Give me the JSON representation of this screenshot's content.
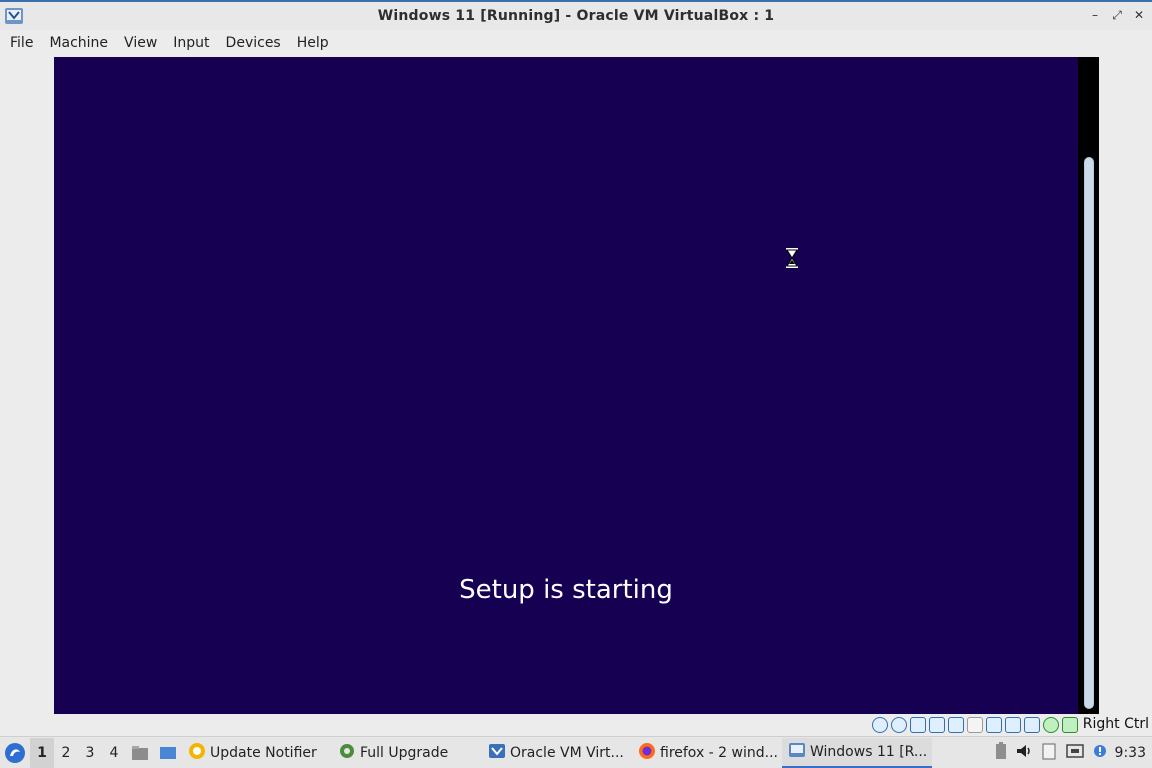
{
  "window": {
    "title": "Windows 11  [Running] - Oracle VM VirtualBox : 1",
    "controls": {
      "minimize": "–",
      "restore": "⤢",
      "close": "✕"
    }
  },
  "menu": [
    "File",
    "Machine",
    "View",
    "Input",
    "Devices",
    "Help"
  ],
  "vm": {
    "message": "Setup is starting",
    "background_color": "#160052"
  },
  "statusbar": {
    "indicators": [
      "hard-disk-icon",
      "optical-drive-icon",
      "audio-icon",
      "network-icon",
      "usb-icon",
      "shared-folders-icon",
      "display-icon",
      "video-capture-icon",
      "cpu-icon",
      "mouse-integration-icon",
      "keyboard-icon"
    ],
    "host_key": "Right Ctrl"
  },
  "taskbar": {
    "workspaces": [
      "1",
      "2",
      "3",
      "4"
    ],
    "tasks": [
      {
        "label": "Update Notifier",
        "icon": "update-icon"
      },
      {
        "label": "Full Upgrade",
        "icon": "gear-icon"
      },
      {
        "label": "Oracle VM Virt...",
        "icon": "virtualbox-icon"
      },
      {
        "label": "firefox - 2 wind...",
        "icon": "firefox-icon"
      },
      {
        "label": "Windows 11  [R...",
        "icon": "vm-icon"
      }
    ],
    "clock": "9:33"
  }
}
